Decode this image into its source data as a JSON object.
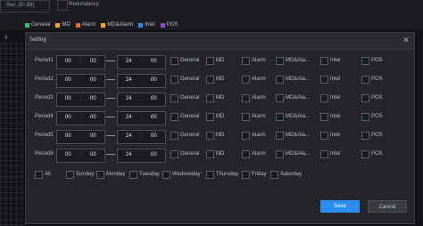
{
  "background": {
    "sec_field": "Sec. (0~30)",
    "redundancy_label": "Redundancy",
    "side_mark": "4",
    "legend": [
      {
        "label": "General",
        "color": "#2fc07a"
      },
      {
        "label": "MD",
        "color": "#f5a623"
      },
      {
        "label": "Alarm",
        "color": "#f06a2a"
      },
      {
        "label": "MD&Alarm",
        "color": "#f5a623"
      },
      {
        "label": "Intel",
        "color": "#2a8ef5"
      },
      {
        "label": "POS",
        "color": "#8f4bd6"
      }
    ]
  },
  "dialog": {
    "title": "Setting",
    "close_icon": "close-icon",
    "periods": [
      {
        "label": "Period1",
        "start_h": "00",
        "start_m": "00",
        "end_h": "24",
        "end_m": "00"
      },
      {
        "label": "Period2",
        "start_h": "00",
        "start_m": "00",
        "end_h": "24",
        "end_m": "00"
      },
      {
        "label": "Period3",
        "start_h": "00",
        "start_m": "00",
        "end_h": "24",
        "end_m": "00"
      },
      {
        "label": "Period4",
        "start_h": "00",
        "start_m": "00",
        "end_h": "24",
        "end_m": "00"
      },
      {
        "label": "Period5",
        "start_h": "00",
        "start_m": "00",
        "end_h": "24",
        "end_m": "00"
      },
      {
        "label": "Period6",
        "start_h": "00",
        "start_m": "00",
        "end_h": "24",
        "end_m": "00"
      }
    ],
    "event_types": [
      "General",
      "MD",
      "Alarm",
      "MD&Ala...",
      "Intel",
      "POS"
    ],
    "days": [
      "All",
      "Sunday",
      "Monday",
      "Tuesday",
      "Wednesday",
      "Thursday",
      "Friday",
      "Saturday"
    ],
    "save_label": "Save",
    "cancel_label": "Cancel"
  }
}
